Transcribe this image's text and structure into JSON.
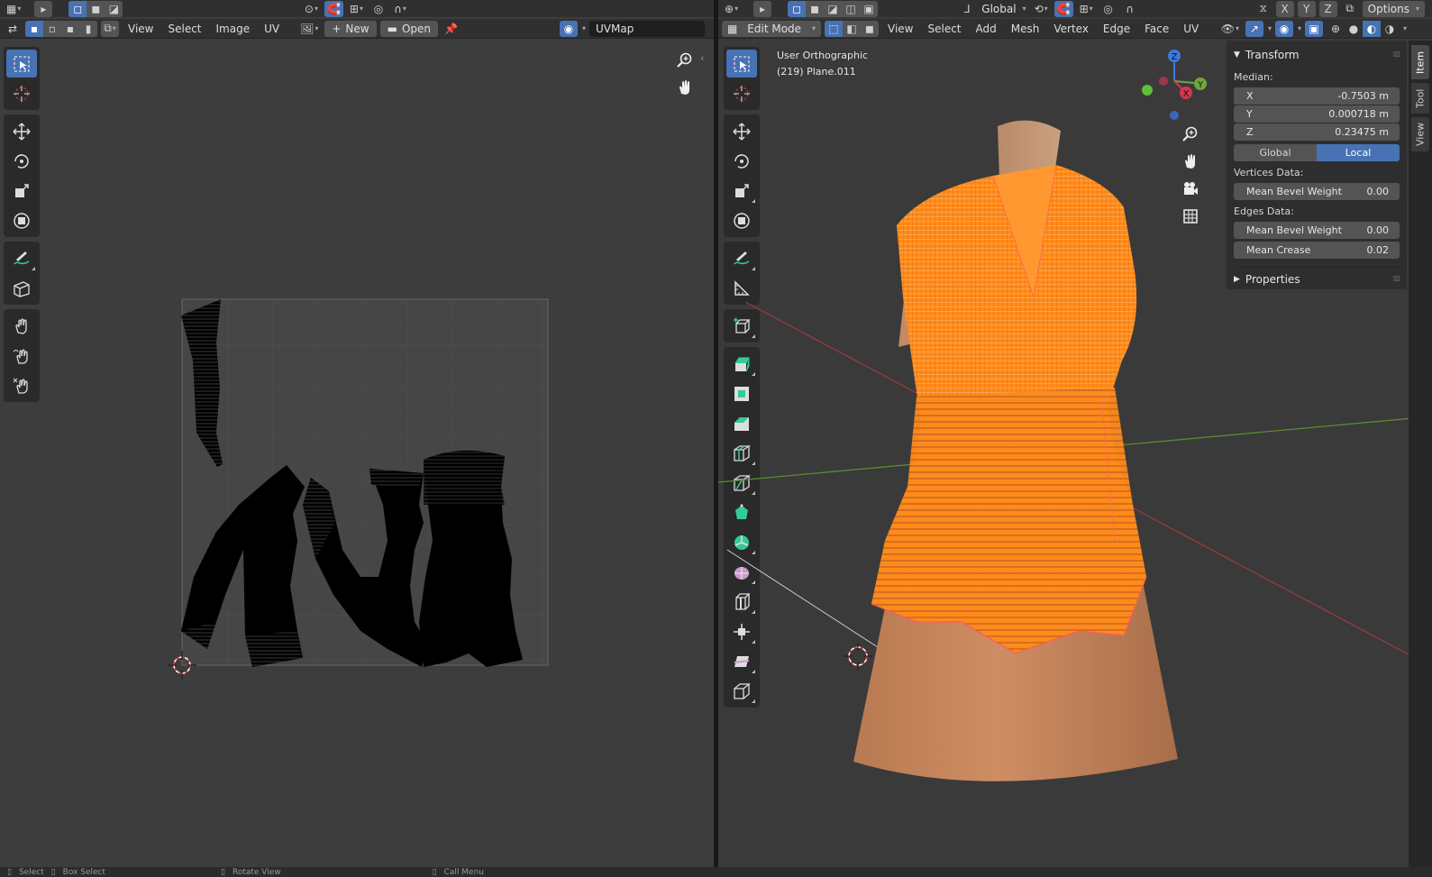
{
  "uv_editor": {
    "menus": [
      "View",
      "Select",
      "Image",
      "UV"
    ],
    "new_label": "New",
    "open_label": "Open",
    "uvmap_name": "UVMap"
  },
  "viewport": {
    "mode_label": "Edit Mode",
    "menus": [
      "View",
      "Select",
      "Add",
      "Mesh",
      "Vertex",
      "Edge",
      "Face",
      "UV"
    ],
    "transform_orientation": "Global",
    "axis_labels": [
      "X",
      "Y",
      "Z"
    ],
    "options_label": "Options",
    "view_name": "User Orthographic",
    "object_name": "(219) Plane.011",
    "gizmo_axes": [
      "X",
      "Y",
      "Z"
    ]
  },
  "sidebar": {
    "panel_title": "Transform",
    "median_label": "Median:",
    "x_label": "X",
    "x_value": "-0.7503 m",
    "y_label": "Y",
    "y_value": "0.000718 m",
    "z_label": "Z",
    "z_value": "0.23475 m",
    "global_label": "Global",
    "local_label": "Local",
    "vertices_label": "Vertices Data:",
    "v_bevel_label": "Mean Bevel Weight",
    "v_bevel_value": "0.00",
    "edges_label": "Edges Data:",
    "e_bevel_label": "Mean Bevel Weight",
    "e_bevel_value": "0.00",
    "crease_label": "Mean Crease",
    "crease_value": "0.02",
    "properties_label": "Properties",
    "tabs": [
      "Item",
      "Tool",
      "View"
    ]
  },
  "statusbar": {
    "items": [
      "Select",
      "Box Select",
      "Rotate View",
      "Call Menu"
    ]
  },
  "colors": {
    "accent": "#4772b3",
    "mesh_selected": "#ff8a1a",
    "body": "#c8865a"
  }
}
